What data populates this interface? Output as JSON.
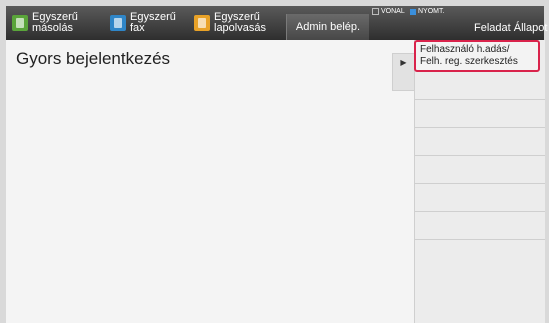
{
  "topbar": {
    "copy": {
      "line1": "Egyszerű",
      "line2": "másolás",
      "icon": "copy-icon"
    },
    "fax": {
      "line1": "Egyszerű",
      "line2": "fax",
      "icon": "fax-icon"
    },
    "scan": {
      "line1": "Egyszerű",
      "line2": "lapolvasás",
      "icon": "scan-icon"
    },
    "admin_label": "Admin belép.",
    "line_indicator": "VONAL",
    "print_indicator": "NYOMT.",
    "job_status_label": "Feladat Állapot"
  },
  "main": {
    "title": "Gyors bejelentkezés",
    "expand_glyph": "▶"
  },
  "side_panel": {
    "action_line1": "Felhasználó h.adás/",
    "action_line2": "Felh. reg. szerkesztés"
  },
  "colors": {
    "highlight_border": "#d9234b",
    "print_indicator": "#3a8fdc"
  }
}
